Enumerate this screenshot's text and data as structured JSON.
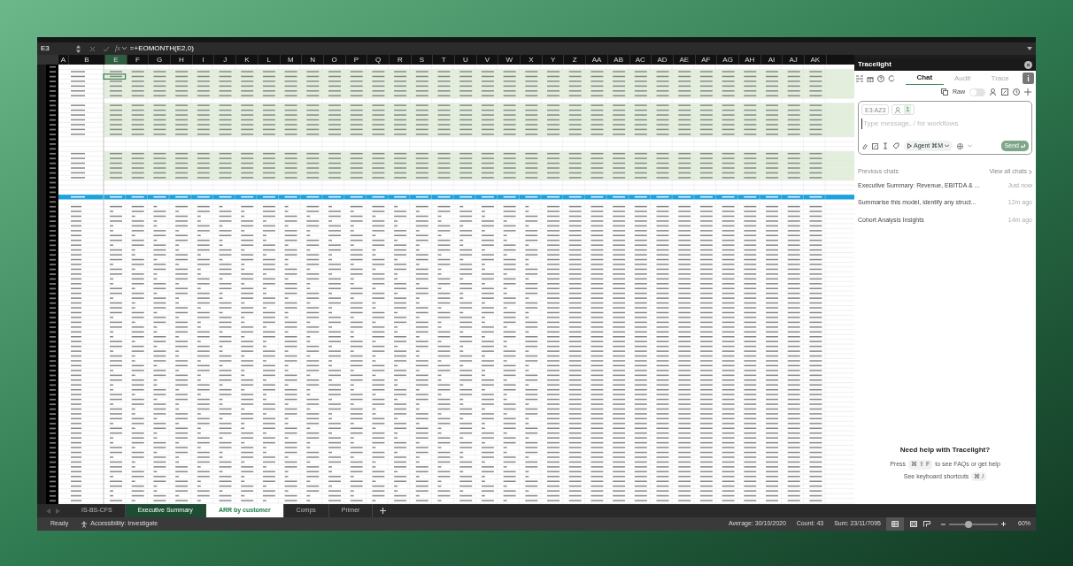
{
  "formula_bar": {
    "cell_ref": "E3",
    "fx": "fx",
    "formula": "=+EOMONTH(E2,0)"
  },
  "columns": [
    "A",
    "B",
    "E",
    "F",
    "G",
    "H",
    "I",
    "J",
    "K",
    "L",
    "M",
    "N",
    "O",
    "P",
    "Q",
    "R",
    "S",
    "T",
    "U",
    "V",
    "W",
    "X",
    "Y",
    "Z",
    "AA",
    "AB",
    "AC",
    "AD",
    "AE",
    "AF",
    "AG",
    "AH",
    "AI",
    "AJ",
    "AK"
  ],
  "sheet_tabs": [
    {
      "label": "IS-BS-CFS",
      "selected": false
    },
    {
      "label": "Executive Summary",
      "selected": false,
      "color": "#1f4d34"
    },
    {
      "label": "ARR by customer",
      "selected": true
    },
    {
      "label": "Comps",
      "selected": false
    },
    {
      "label": "Primer",
      "selected": false
    }
  ],
  "status_bar": {
    "status": "Ready",
    "accessibility": "Accessibility: Investigate",
    "average": "Average: 30/10/2020",
    "count": "Count: 43",
    "sum": "Sum: 23/11/7095",
    "zoom_slider": {
      "level": 0.38
    },
    "zoom": "60%"
  },
  "panel": {
    "title": "Tracelight",
    "tabs": [
      {
        "label": "Chat",
        "selected": true
      },
      {
        "label": "Audit",
        "selected": false
      },
      {
        "label": "Trace",
        "selected": false
      }
    ],
    "raw": {
      "label": "Raw",
      "on": false
    },
    "range_chip": "E3:AZ3",
    "people_count": "1",
    "placeholder": "Type message, / for workflows",
    "agent": "Agent ⌘M",
    "send": "Send",
    "previous_chats": "Previous chats",
    "view_all": "View all chats",
    "chats": [
      {
        "title": "Executive Summary: Revenue, EBITDA & ...",
        "time": "Just now"
      },
      {
        "title": "Summarise this model, identify any struct...",
        "time": "12m ago"
      },
      {
        "title": "Cohort Analysis Insights",
        "time": "14m ago"
      }
    ],
    "help": {
      "title": "Need help with Tracelight?",
      "press": "Press",
      "faq_keys": "⌘ ⇧ F",
      "faq_text": "to see FAQs or get help",
      "shortcuts": "See keyboard shortcuts",
      "shortcut_keys": "⌘ /"
    }
  }
}
